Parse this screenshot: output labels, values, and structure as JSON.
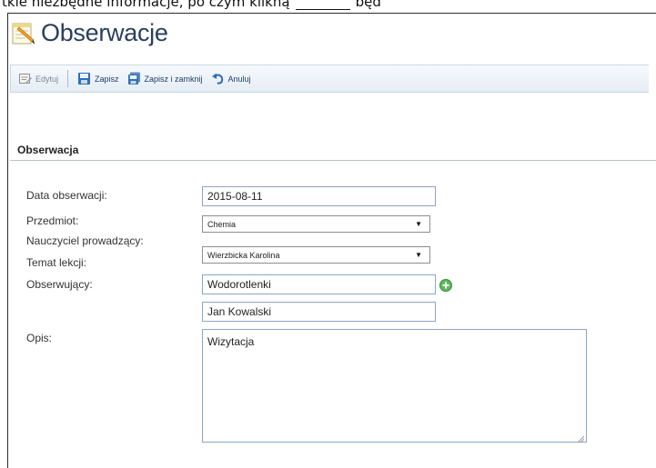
{
  "top_text": {
    "before": "tkie niezbędne informacje, po czym klikną",
    "after": "będ"
  },
  "header": {
    "title": "Obserwacje"
  },
  "toolbar": {
    "edit_label": "Edytuj",
    "save_label": "Zapisz",
    "save_close_label": "Zapisz i zamknij",
    "cancel_label": "Anuluj"
  },
  "section": {
    "title": "Obserwacja"
  },
  "form": {
    "date_label": "Data obserwacji:",
    "date_value": "2015-08-11",
    "subject_label": "Przedmiot:",
    "subject_value": "Chemia",
    "teacher_label": "Nauczyciel prowadzący:",
    "teacher_value": "Wierzbicka Karolina",
    "topic_label": "Temat lekcji:",
    "topic_value": "Wodorotlenki",
    "observer_label": "Obserwujący:",
    "observer_value": "Jan Kowalski",
    "description_label": "Opis:",
    "description_value": "Wizytacja"
  },
  "colors": {
    "title": "#2a3f5c",
    "toolbar_text": "#1f3d66",
    "field_border": "#8aa6c9",
    "add_icon": "#5cb85c"
  },
  "icons": {
    "title": "notepad-icon",
    "edit": "edit-icon",
    "save": "save-icon",
    "save_close": "save-close-icon",
    "cancel": "undo-icon",
    "add": "add-icon"
  }
}
